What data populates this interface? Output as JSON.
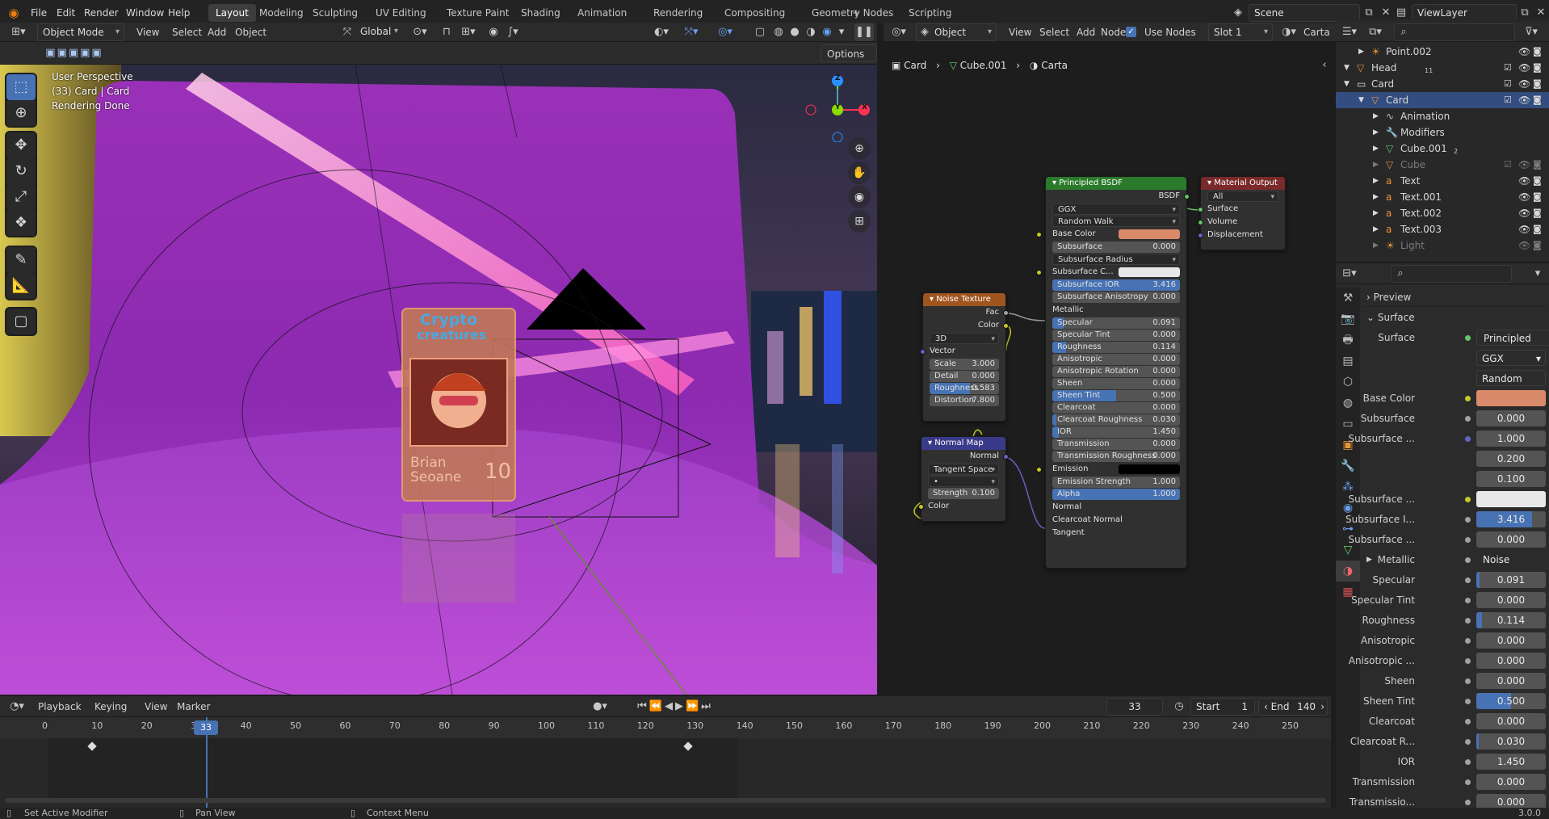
{
  "topbar": {
    "menus": [
      "File",
      "Edit",
      "Render",
      "Window",
      "Help"
    ],
    "workspaces": [
      "Layout",
      "Modeling",
      "Sculpting",
      "UV Editing",
      "Texture Paint",
      "Shading",
      "Animation",
      "Rendering",
      "Compositing",
      "Geometry Nodes",
      "Scripting"
    ],
    "active_workspace": "Layout",
    "add_tab": "+",
    "scene": "Scene",
    "view_layer": "ViewLayer"
  },
  "viewport": {
    "mode": "Object Mode",
    "menus": [
      "View",
      "Select",
      "Add",
      "Object"
    ],
    "transform_orientation": "Global",
    "options": "Options",
    "info_line1": "User Perspective",
    "info_line2": "(33) Card | Card",
    "info_line3": "Rendering Done",
    "card_title": "Crypto",
    "card_subtitle": "creatures",
    "card_name_first": "Brian",
    "card_name_last": "Seoane",
    "card_number": "10",
    "gizmo_z": "Z",
    "gizmo_y": "Y",
    "gizmo_x": "X"
  },
  "node_editor": {
    "type": "Object",
    "menus": [
      "View",
      "Select",
      "Add",
      "Node"
    ],
    "use_nodes": "Use Nodes",
    "slot": "Slot 1",
    "material": "Carta",
    "breadcrumb": [
      "Card",
      "Cube.001",
      "Carta"
    ],
    "bsdf": {
      "title": "Principled BSDF",
      "output": "BSDF",
      "distribution": "GGX",
      "subsurface_method": "Random Walk",
      "rows": [
        {
          "label": "Base Color",
          "type": "color",
          "color": "#d98a6a"
        },
        {
          "label": "Subsurface",
          "type": "slider",
          "value": "0.000",
          "fill": 0
        },
        {
          "label": "Subsurface Radius",
          "type": "drop"
        },
        {
          "label": "Subsurface C...",
          "type": "color",
          "color": "#e8e8e8"
        },
        {
          "label": "Subsurface IOR",
          "type": "slider",
          "value": "3.416",
          "fill": 1
        },
        {
          "label": "Subsurface Anisotropy",
          "type": "slider",
          "value": "0.000",
          "fill": 0
        },
        {
          "label": "Metallic",
          "type": "plain"
        },
        {
          "label": "Specular",
          "type": "slider",
          "value": "0.091",
          "fill": 0.09
        },
        {
          "label": "Specular Tint",
          "type": "slider",
          "value": "0.000",
          "fill": 0
        },
        {
          "label": "Roughness",
          "type": "slider",
          "value": "0.114",
          "fill": 0.11
        },
        {
          "label": "Anisotropic",
          "type": "slider",
          "value": "0.000",
          "fill": 0
        },
        {
          "label": "Anisotropic Rotation",
          "type": "slider",
          "value": "0.000",
          "fill": 0
        },
        {
          "label": "Sheen",
          "type": "slider",
          "value": "0.000",
          "fill": 0
        },
        {
          "label": "Sheen Tint",
          "type": "slider",
          "value": "0.500",
          "fill": 0.5
        },
        {
          "label": "Clearcoat",
          "type": "slider",
          "value": "0.000",
          "fill": 0
        },
        {
          "label": "Clearcoat Roughness",
          "type": "slider",
          "value": "0.030",
          "fill": 0.03
        },
        {
          "label": "IOR",
          "type": "slider",
          "value": "1.450",
          "fill": 0.05
        },
        {
          "label": "Transmission",
          "type": "slider",
          "value": "0.000",
          "fill": 0
        },
        {
          "label": "Transmission Roughness",
          "type": "slider",
          "value": "0.000",
          "fill": 0
        },
        {
          "label": "Emission",
          "type": "color",
          "color": "#000000"
        },
        {
          "label": "Emission Strength",
          "type": "slider",
          "value": "1.000",
          "fill": 0
        },
        {
          "label": "Alpha",
          "type": "slider",
          "value": "1.000",
          "fill": 1
        },
        {
          "label": "Normal",
          "type": "plain"
        },
        {
          "label": "Clearcoat Normal",
          "type": "plain"
        },
        {
          "label": "Tangent",
          "type": "plain"
        }
      ]
    },
    "output": {
      "title": "Material Output",
      "target": "All",
      "inputs": [
        "Surface",
        "Volume",
        "Displacement"
      ]
    },
    "noise": {
      "title": "Noise Texture",
      "outputs": [
        "Fac",
        "Color"
      ],
      "dimensions": "3D",
      "vector": "Vector",
      "scale_label": "Scale",
      "scale": "3.000",
      "detail_label": "Detail",
      "detail": "0.000",
      "roughness_label": "Roughness",
      "roughness": "0.583",
      "distortion_label": "Distortion",
      "distortion": "7.800"
    },
    "normal_map": {
      "title": "Normal Map",
      "output": "Normal",
      "space": "Tangent Space",
      "uv": "•",
      "strength_label": "Strength",
      "strength": "0.100",
      "color": "Color"
    }
  },
  "outliner": {
    "rows": [
      {
        "name": "Point.002",
        "indent": 1,
        "kind": "light"
      },
      {
        "name": "Head",
        "indent": 0,
        "kind": "mesh",
        "badge": "11"
      },
      {
        "name": "Card",
        "indent": 0,
        "kind": "collection"
      },
      {
        "name": "Card",
        "indent": 1,
        "kind": "mesh",
        "selected": true
      },
      {
        "name": "Animation",
        "indent": 2,
        "kind": "anim"
      },
      {
        "name": "Modifiers",
        "indent": 2,
        "kind": "mod"
      },
      {
        "name": "Cube.001",
        "indent": 2,
        "kind": "meshdata",
        "badge": "2"
      },
      {
        "name": "Cube",
        "indent": 2,
        "kind": "mesh",
        "dim": true
      },
      {
        "name": "Text",
        "indent": 2,
        "kind": "text"
      },
      {
        "name": "Text.001",
        "indent": 2,
        "kind": "text"
      },
      {
        "name": "Text.002",
        "indent": 2,
        "kind": "text"
      },
      {
        "name": "Text.003",
        "indent": 2,
        "kind": "text"
      },
      {
        "name": "Light",
        "indent": 2,
        "kind": "light",
        "dim": true
      }
    ]
  },
  "properties": {
    "preview": "Preview",
    "surface_panel": "Surface",
    "surface_label": "Surface",
    "surface_value": "Principled BSDF",
    "distribution": "GGX",
    "subsurface_method": "Random Walk",
    "rows": [
      {
        "label": "Base Color",
        "type": "color",
        "color": "#d98a6a",
        "dot": "yel"
      },
      {
        "label": "Subsurface",
        "value": "0.000",
        "fill": 0
      },
      {
        "label": "Subsurface ...",
        "value": "1.000",
        "fill": 0,
        "dot": "pur"
      },
      {
        "label": "",
        "value": "0.200",
        "fill": 0,
        "nodot": true
      },
      {
        "label": "",
        "value": "0.100",
        "fill": 0,
        "nodot": true
      },
      {
        "label": "Subsurface ...",
        "type": "color",
        "color": "#e8e8e8",
        "dot": "yel"
      },
      {
        "label": "Subsurface I...",
        "value": "3.416",
        "fill": 0.8
      },
      {
        "label": "Subsurface ...",
        "value": "0.000",
        "fill": 0
      },
      {
        "label": "Metallic",
        "type": "link",
        "value": "Noise Texture"
      },
      {
        "label": "Specular",
        "value": "0.091",
        "fill": 0.05
      },
      {
        "label": "Specular Tint",
        "value": "0.000",
        "fill": 0
      },
      {
        "label": "Roughness",
        "value": "0.114",
        "fill": 0.08
      },
      {
        "label": "Anisotropic",
        "value": "0.000",
        "fill": 0
      },
      {
        "label": "Anisotropic ...",
        "value": "0.000",
        "fill": 0
      },
      {
        "label": "Sheen",
        "value": "0.000",
        "fill": 0
      },
      {
        "label": "Sheen Tint",
        "value": "0.500",
        "fill": 0.5
      },
      {
        "label": "Clearcoat",
        "value": "0.000",
        "fill": 0
      },
      {
        "label": "Clearcoat R...",
        "value": "0.030",
        "fill": 0.03
      },
      {
        "label": "IOR",
        "value": "1.450",
        "fill": 0
      },
      {
        "label": "Transmission",
        "value": "0.000",
        "fill": 0
      },
      {
        "label": "Transmissio...",
        "value": "0.000",
        "fill": 0
      }
    ]
  },
  "timeline": {
    "menus": [
      "Playback",
      "Keying",
      "View",
      "Marker"
    ],
    "current_frame": "33",
    "start_label": "Start",
    "start": "1",
    "end_label": "End",
    "end": "140",
    "ticks": [
      "0",
      "10",
      "20",
      "30",
      "40",
      "50",
      "60",
      "70",
      "80",
      "90",
      "100",
      "110",
      "120",
      "130",
      "140",
      "150",
      "160",
      "170",
      "180",
      "190",
      "200",
      "210",
      "220",
      "230",
      "240",
      "250"
    ]
  },
  "statusbar": {
    "left": "Set Active Modifier",
    "middle": "Pan View",
    "right": "Context Menu",
    "version": "3.0.0"
  }
}
